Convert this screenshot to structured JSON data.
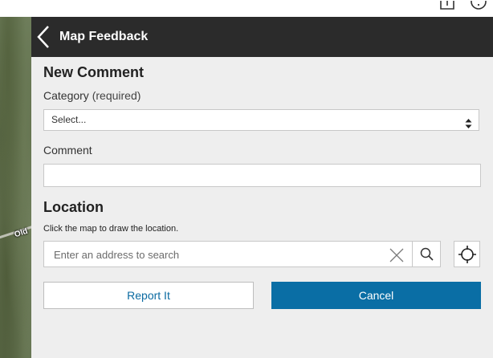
{
  "header": {
    "title": "Map Feedback"
  },
  "comment_section": {
    "title": "New Comment"
  },
  "category": {
    "label": "Category",
    "required_note": "(required)",
    "selected": "Select..."
  },
  "comment": {
    "label": "Comment",
    "value": ""
  },
  "location": {
    "title": "Location",
    "hint": "Click the map to draw the location.",
    "search_placeholder": "Enter an address to search"
  },
  "buttons": {
    "report": "Report It",
    "cancel": "Cancel"
  },
  "map": {
    "road_label": "Old"
  },
  "colors": {
    "header_bg": "#2b2b2b",
    "panel_bg": "#eeeeee",
    "accent": "#0a6ea5",
    "link": "#0a6aa1"
  }
}
